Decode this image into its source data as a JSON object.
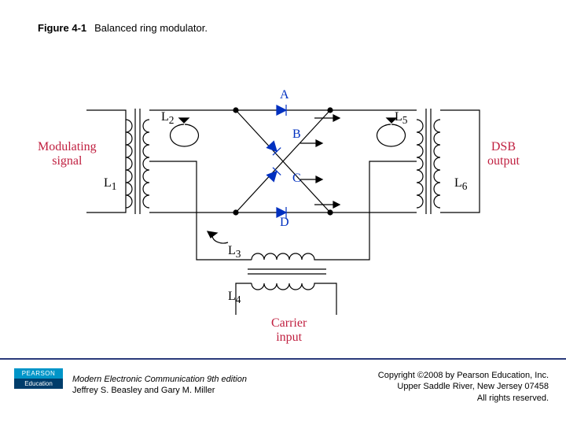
{
  "figure": {
    "number": "Figure 4-1",
    "caption": "Balanced ring modulator."
  },
  "labels": {
    "modulating": "Modulating\nsignal",
    "dsb": "DSB\noutput",
    "carrier": "Carrier\ninput",
    "L1": "L",
    "L1s": "1",
    "L2": "L",
    "L2s": "2",
    "L3": "L",
    "L3s": "3",
    "L4": "L",
    "L4s": "4",
    "L5": "L",
    "L5s": "5",
    "L6": "L",
    "L6s": "6",
    "A": "A",
    "B": "B",
    "C": "C",
    "D": "D"
  },
  "publisher": {
    "brand_top": "PEARSON",
    "brand_bot": "Education"
  },
  "book": {
    "title": "Modern Electronic Communication 9th edition",
    "authors": "Jeffrey S. Beasley and Gary M. Miller"
  },
  "copyright": {
    "line1": "Copyright ©2008 by Pearson Education, Inc.",
    "line2": "Upper Saddle River, New Jersey 07458",
    "line3": "All rights reserved."
  },
  "colors": {
    "red": "#c02040",
    "blue": "#0030c0",
    "rule": "#2a3a7a",
    "logo1": "#0095c8",
    "logo2": "#003d6b"
  }
}
